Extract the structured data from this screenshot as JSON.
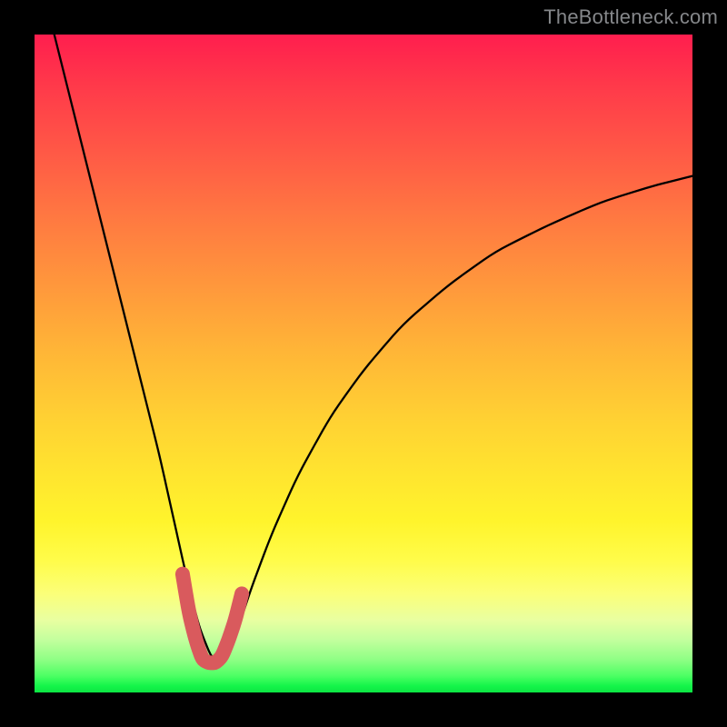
{
  "watermark": "TheBottleneck.com",
  "chart_data": {
    "type": "line",
    "title": "",
    "xlabel": "",
    "ylabel": "",
    "x_range": [
      0,
      100
    ],
    "y_range": [
      0,
      100
    ],
    "grid": false,
    "legend": false,
    "curve": {
      "description": "Black V-shaped bottleneck curve with minimum near x≈27. Left branch starting at top-left falling steeply, rounded minimum, right branch rising with decreasing slope toward upper-right.",
      "name": "bottleneck",
      "color": "#000000",
      "x": [
        3,
        5,
        8,
        11,
        14,
        17,
        19,
        21,
        23,
        25,
        27,
        29,
        31,
        33,
        36,
        40,
        45,
        50,
        56,
        63,
        70,
        78,
        86,
        94,
        100
      ],
      "y": [
        100,
        92,
        80,
        68,
        56,
        44,
        36,
        27,
        18,
        10,
        5,
        5,
        10,
        16,
        24,
        33,
        42,
        49,
        56,
        62,
        67,
        71,
        74.5,
        77,
        78.5
      ]
    },
    "highlight": {
      "description": "Red rounded highlight segment at the minimum of the curve (the 'U' bottom)",
      "name": "bottleneck-minimum",
      "color": "#d95a5d",
      "x": [
        22.5,
        23.5,
        24.5,
        25.5,
        26.5,
        27.5,
        28.5,
        29.5,
        30.5,
        31.5
      ],
      "y": [
        18,
        12,
        8,
        5,
        4.5,
        4.5,
        5.5,
        8,
        11,
        15
      ]
    },
    "background_gradient": {
      "top": "#ff1e4e",
      "mid": "#ffd033",
      "bottom": "#0ce543"
    }
  }
}
